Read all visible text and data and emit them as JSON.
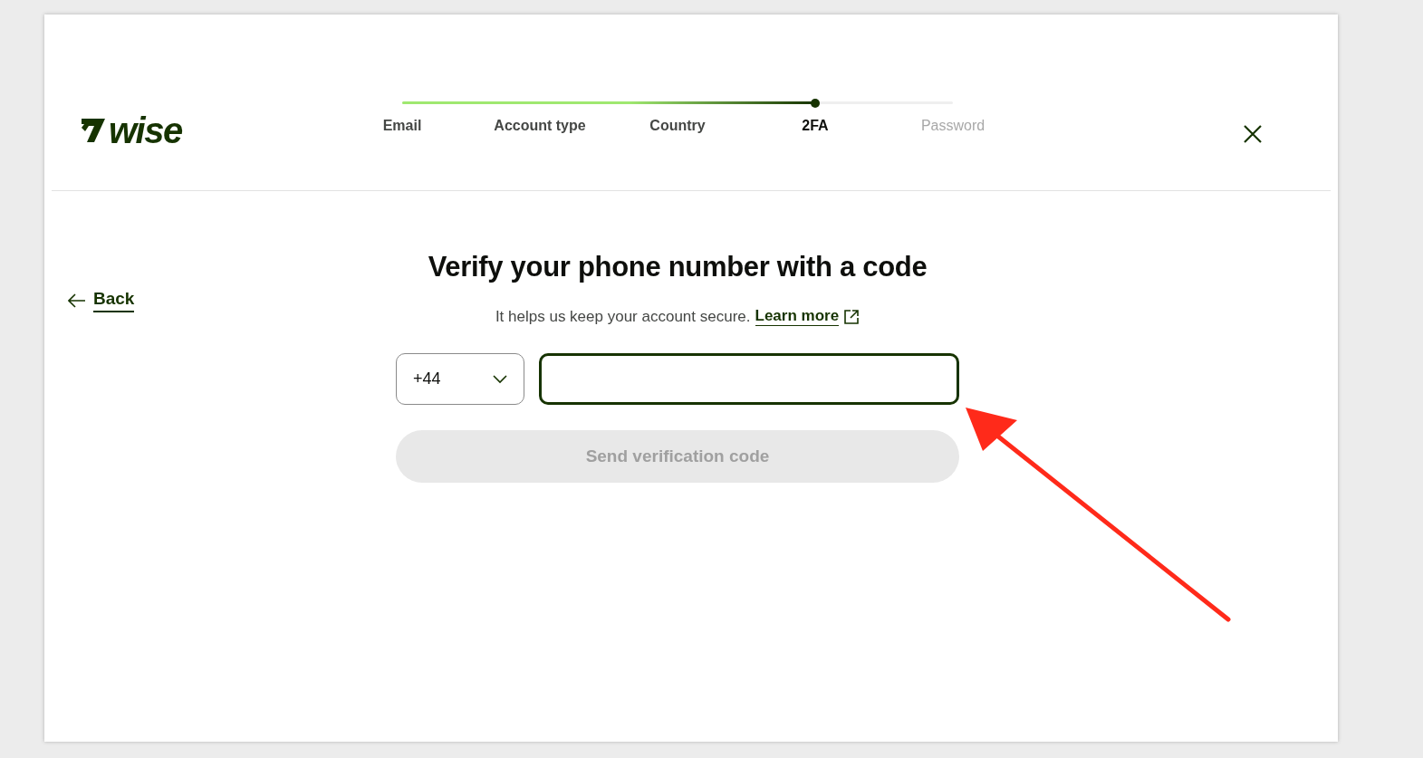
{
  "logo": {
    "text": "wise"
  },
  "steps": [
    {
      "label": "Email",
      "done": true,
      "selected": false
    },
    {
      "label": "Account type",
      "done": true,
      "selected": false
    },
    {
      "label": "Country",
      "done": true,
      "selected": false
    },
    {
      "label": "2FA",
      "done": false,
      "selected": true
    },
    {
      "label": "Password",
      "done": false,
      "selected": false
    }
  ],
  "progress": {
    "level": 0.75
  },
  "back": {
    "label": "Back"
  },
  "title": "Verify your phone number with a code",
  "subtitle": "It helps us keep your account secure.",
  "learn_more": "Learn more",
  "country_code": {
    "value": "+44"
  },
  "phone": {
    "focused": true
  },
  "send_button": {
    "label": "Send verification code",
    "disabled": true
  },
  "annotation": {
    "kind": "arrow",
    "color": "#ff2a1a"
  }
}
